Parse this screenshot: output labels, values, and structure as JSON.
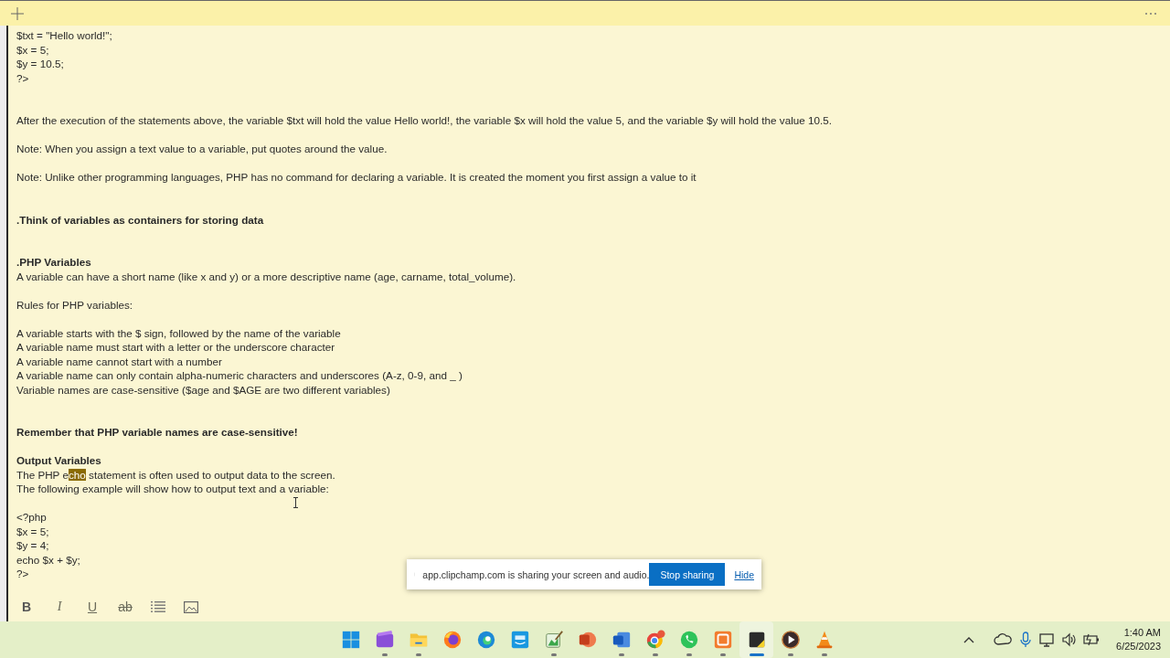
{
  "note": {
    "lines": [
      {
        "kind": "text",
        "text": "$txt = \"Hello world!\";"
      },
      {
        "kind": "text",
        "text": "$x = 5;"
      },
      {
        "kind": "text",
        "text": "$y = 10.5;"
      },
      {
        "kind": "text",
        "text": "?>"
      },
      {
        "kind": "blank"
      },
      {
        "kind": "blank"
      },
      {
        "kind": "text",
        "text": "After the execution of the statements above, the variable $txt will hold the value Hello world!, the variable $x will hold the value 5, and the variable $y will hold the value 10.5."
      },
      {
        "kind": "blank"
      },
      {
        "kind": "text",
        "text": "Note: When you assign a text value to a variable, put quotes around the value."
      },
      {
        "kind": "blank"
      },
      {
        "kind": "text",
        "text": "Note: Unlike other programming languages, PHP has no command for declaring a variable. It is created the moment you first assign a value to it"
      },
      {
        "kind": "blank"
      },
      {
        "kind": "blank"
      },
      {
        "kind": "heading",
        "text": ".Think of variables as containers for storing data"
      },
      {
        "kind": "blank"
      },
      {
        "kind": "blank"
      },
      {
        "kind": "heading",
        "text": ".PHP Variables"
      },
      {
        "kind": "text",
        "text": "A variable can have a short name (like x and y) or a more descriptive name (age, carname, total_volume)."
      },
      {
        "kind": "blank"
      },
      {
        "kind": "text",
        "text": "Rules for PHP variables:"
      },
      {
        "kind": "blank"
      },
      {
        "kind": "text",
        "text": "A variable starts with the $ sign, followed by the name of the variable"
      },
      {
        "kind": "text",
        "text": "A variable name must start with a letter or the underscore character"
      },
      {
        "kind": "text",
        "text": "A variable name cannot start with a number"
      },
      {
        "kind": "text",
        "text": "A variable name can only contain alpha-numeric characters and underscores (A-z, 0-9, and _ )"
      },
      {
        "kind": "text",
        "text": "Variable names are case-sensitive ($age and $AGE are two different variables)"
      },
      {
        "kind": "blank"
      },
      {
        "kind": "blank"
      },
      {
        "kind": "heading",
        "text": "Remember that PHP variable names are case-sensitive!"
      },
      {
        "kind": "blank"
      },
      {
        "kind": "heading",
        "text": "Output Variables"
      },
      {
        "kind": "segments",
        "segments": [
          {
            "text": "The PHP e",
            "highlighted": false
          },
          {
            "text": "cho",
            "highlighted": true
          },
          {
            "text": " statement is often used to output data to the screen.",
            "highlighted": false
          }
        ]
      },
      {
        "kind": "text",
        "text": "The following example will show how to output text and a variable:"
      },
      {
        "kind": "blank"
      },
      {
        "kind": "text",
        "text": "<?php"
      },
      {
        "kind": "text",
        "text": "$x = 5;"
      },
      {
        "kind": "text",
        "text": "$y = 4;"
      },
      {
        "kind": "text",
        "text": "echo $x + $y;"
      },
      {
        "kind": "text",
        "text": "?>"
      }
    ],
    "toolbar": [
      {
        "kind": "bold",
        "label": "B"
      },
      {
        "kind": "italic",
        "label": "I"
      },
      {
        "kind": "underline",
        "label": "U"
      },
      {
        "kind": "strike",
        "label": "ab"
      },
      {
        "kind": "list"
      },
      {
        "kind": "image"
      }
    ]
  },
  "share_bar": {
    "message": "app.clipchamp.com is sharing your screen and audio.",
    "button": "Stop sharing",
    "link": "Hide"
  },
  "taskbar": {
    "apps": [
      {
        "kind": "start",
        "running": false,
        "active": false
      },
      {
        "kind": "clipchamp",
        "running": true,
        "active": false
      },
      {
        "kind": "folder",
        "running": true,
        "active": false
      },
      {
        "kind": "firefox",
        "running": false,
        "active": false
      },
      {
        "kind": "edge",
        "running": false,
        "active": false
      },
      {
        "kind": "prime",
        "running": false,
        "active": false
      },
      {
        "kind": "paint",
        "running": true,
        "active": false
      },
      {
        "kind": "powerpoint",
        "running": false,
        "active": false
      },
      {
        "kind": "word",
        "running": true,
        "active": false
      },
      {
        "kind": "chrome",
        "running": true,
        "active": false
      },
      {
        "kind": "whatsapp",
        "running": true,
        "active": false
      },
      {
        "kind": "xampp",
        "running": true,
        "active": false
      },
      {
        "kind": "sticky",
        "running": true,
        "active": true
      },
      {
        "kind": "player",
        "running": true,
        "active": false
      },
      {
        "kind": "vlc",
        "running": true,
        "active": false
      }
    ],
    "time": "1:40 AM",
    "date": "6/25/2023"
  }
}
